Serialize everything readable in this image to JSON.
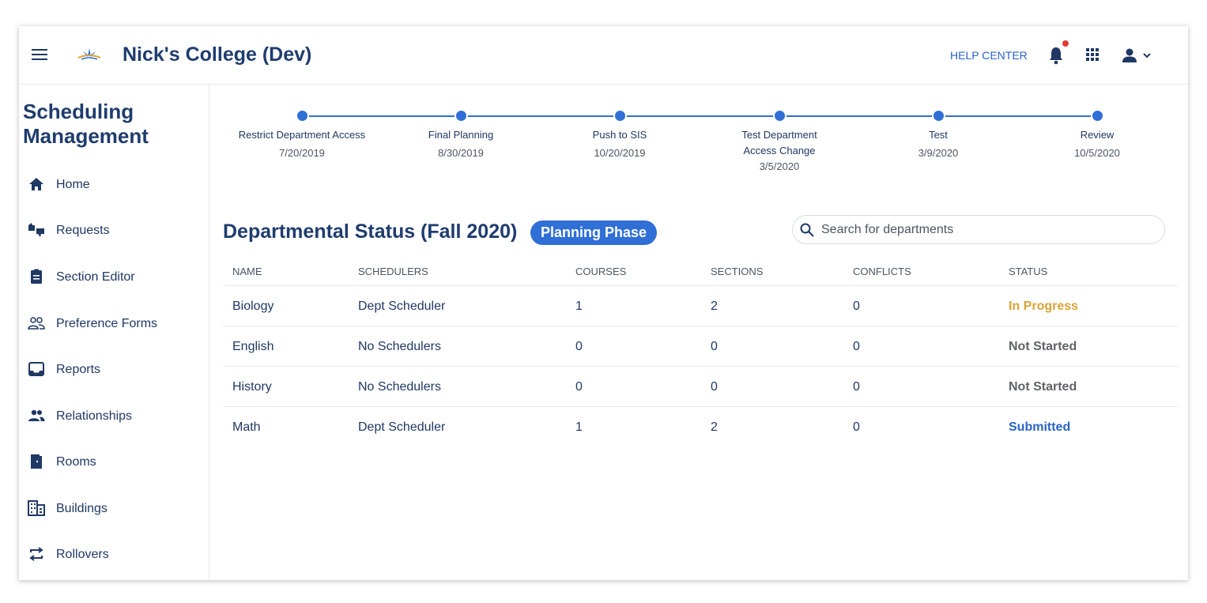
{
  "header": {
    "title": "Nick's College (Dev)",
    "help_label": "HELP CENTER",
    "icons": [
      "menu-icon",
      "logo",
      "bell-icon",
      "apps-grid-icon",
      "user-icon",
      "chevron-down-icon"
    ],
    "notification_color": "#e53935"
  },
  "sidebar": {
    "title": "Scheduling Management",
    "items": [
      {
        "label": "Home",
        "icon": "home-icon"
      },
      {
        "label": "Requests",
        "icon": "requests-icon"
      },
      {
        "label": "Section Editor",
        "icon": "clipboard-icon"
      },
      {
        "label": "Preference Forms",
        "icon": "people-outline-icon"
      },
      {
        "label": "Reports",
        "icon": "inbox-icon"
      },
      {
        "label": "Relationships",
        "icon": "people-icon"
      },
      {
        "label": "Rooms",
        "icon": "door-icon"
      },
      {
        "label": "Buildings",
        "icon": "building-icon"
      },
      {
        "label": "Rollovers",
        "icon": "swap-icon"
      }
    ]
  },
  "timeline": [
    {
      "label": "Restrict Department Access",
      "date": "7/20/2019"
    },
    {
      "label": "Final Planning",
      "date": "8/30/2019"
    },
    {
      "label": "Push to SIS",
      "date": "10/20/2019"
    },
    {
      "label": "Test Department Access Change",
      "date": "3/5/2020"
    },
    {
      "label": "Test",
      "date": "3/9/2020"
    },
    {
      "label": "Review",
      "date": "10/5/2020"
    }
  ],
  "main": {
    "heading": "Departmental Status (Fall 2020)",
    "phase_badge": "Planning Phase",
    "search_placeholder": "Search for departments"
  },
  "table": {
    "columns": [
      "NAME",
      "SCHEDULERS",
      "COURSES",
      "SECTIONS",
      "CONFLICTS",
      "STATUS"
    ],
    "rows": [
      {
        "name": "Biology",
        "schedulers": "Dept Scheduler",
        "courses": "1",
        "sections": "2",
        "conflicts": "0",
        "status": "In Progress",
        "status_color": "#d9a334"
      },
      {
        "name": "English",
        "schedulers": "No Schedulers",
        "courses": "0",
        "sections": "0",
        "conflicts": "0",
        "status": "Not Started",
        "status_color": "#5f6368"
      },
      {
        "name": "History",
        "schedulers": "No Schedulers",
        "courses": "0",
        "sections": "0",
        "conflicts": "0",
        "status": "Not Started",
        "status_color": "#5f6368"
      },
      {
        "name": "Math",
        "schedulers": "Dept Scheduler",
        "courses": "1",
        "sections": "2",
        "conflicts": "0",
        "status": "Submitted",
        "status_color": "#2a62c9"
      }
    ]
  },
  "colors": {
    "accent": "#2f6fd6",
    "brand_text": "#1f3c6e"
  }
}
